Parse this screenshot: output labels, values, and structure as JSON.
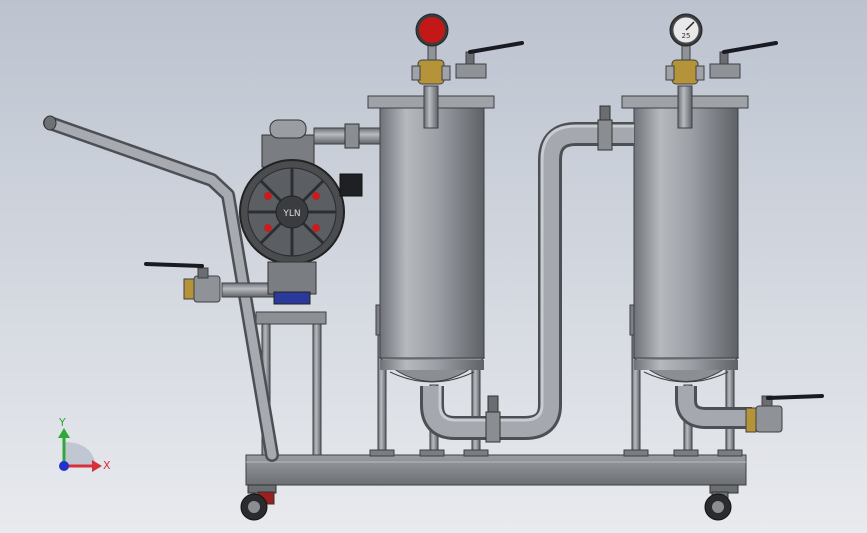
{
  "viewport": {
    "background_top": "#bcc3cf",
    "background_bottom": "#e8eaee"
  },
  "triad": {
    "y_label": "Y",
    "x_label": "X",
    "y_color": "#2faa3a",
    "x_color": "#d8303a",
    "z_color": "#2233cc"
  },
  "gauges": {
    "left_dial_color": "#c41818",
    "right_dial_text": "25"
  },
  "pump": {
    "badge_text": "YLN",
    "accent_color": "#c02020"
  },
  "colors": {
    "steel": "#8a8d93",
    "steel_dark": "#55585d",
    "brass": "#b59338",
    "handle": "#1a1a22",
    "wheel_red": "#9a1f1f"
  }
}
